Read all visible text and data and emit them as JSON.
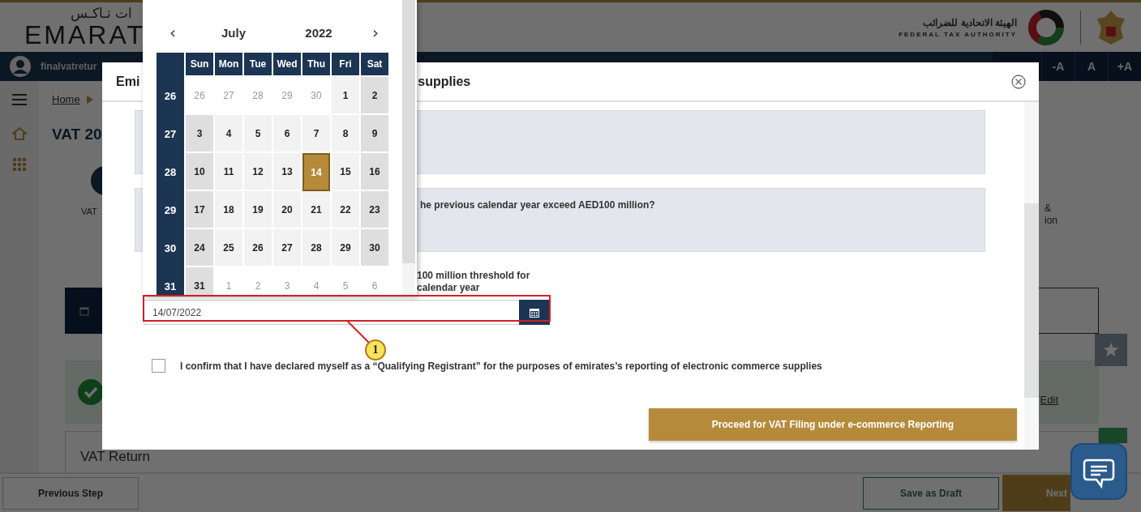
{
  "header": {
    "logo_arabic": "ات تـاكـس",
    "logo_text": "EMARAT",
    "authority_arabic": "الهيئة الاتحادية للضرائب",
    "authority_name": "FEDERAL TAX AUTHORITY"
  },
  "nav": {
    "user": "finalvatretur",
    "font_buttons": [
      "-A",
      "A",
      "+A"
    ]
  },
  "breadcrumb": {
    "home": "Home"
  },
  "page_title": "VAT 20",
  "steps": {
    "first_label": "VAT",
    "last_label_lines": [
      "&",
      "ion"
    ]
  },
  "summary_card": {
    "edit": "Edit"
  },
  "section_title": "VAT Return",
  "footer": {
    "previous": "Previous Step",
    "save": "Save as Draft",
    "next": "Next"
  },
  "modal": {
    "title_start": "Emi",
    "title_end": "supplies",
    "question_text": "he previous calendar year exceed AED100 million?",
    "threshold_lines": [
      "100 million threshold for",
      "calendar year"
    ],
    "date_value": "14/07/2022",
    "confirm": {
      "checked": false,
      "text": "I confirm that I have declared myself as a “Qualifying Registrant” for the purposes of emirates’s reporting of electronic commerce supplies"
    },
    "proceed": "Proceed for VAT Filing under e-commerce Reporting"
  },
  "calendar": {
    "prev": "‹",
    "month": "July",
    "year": "2022",
    "next": "›",
    "weekdays": [
      "Sun",
      "Mon",
      "Tue",
      "Wed",
      "Thu",
      "Fri",
      "Sat"
    ],
    "weeks": [
      {
        "number": "26",
        "days": [
          {
            "day": "26",
            "outside": true,
            "selected": false
          },
          {
            "day": "27",
            "outside": true,
            "selected": false
          },
          {
            "day": "28",
            "outside": true,
            "selected": false
          },
          {
            "day": "29",
            "outside": true,
            "selected": false
          },
          {
            "day": "30",
            "outside": true,
            "selected": false
          },
          {
            "day": "1",
            "outside": false,
            "selected": false
          },
          {
            "day": "2",
            "outside": false,
            "selected": false
          }
        ]
      },
      {
        "number": "27",
        "days": [
          {
            "day": "3",
            "outside": false,
            "selected": false
          },
          {
            "day": "4",
            "outside": false,
            "selected": false
          },
          {
            "day": "5",
            "outside": false,
            "selected": false
          },
          {
            "day": "6",
            "outside": false,
            "selected": false
          },
          {
            "day": "7",
            "outside": false,
            "selected": false
          },
          {
            "day": "8",
            "outside": false,
            "selected": false
          },
          {
            "day": "9",
            "outside": false,
            "selected": false
          }
        ]
      },
      {
        "number": "28",
        "days": [
          {
            "day": "10",
            "outside": false,
            "selected": false
          },
          {
            "day": "11",
            "outside": false,
            "selected": false
          },
          {
            "day": "12",
            "outside": false,
            "selected": false
          },
          {
            "day": "13",
            "outside": false,
            "selected": false
          },
          {
            "day": "14",
            "outside": false,
            "selected": true
          },
          {
            "day": "15",
            "outside": false,
            "selected": false
          },
          {
            "day": "16",
            "outside": false,
            "selected": false
          }
        ]
      },
      {
        "number": "29",
        "days": [
          {
            "day": "17",
            "outside": false,
            "selected": false
          },
          {
            "day": "18",
            "outside": false,
            "selected": false
          },
          {
            "day": "19",
            "outside": false,
            "selected": false
          },
          {
            "day": "20",
            "outside": false,
            "selected": false
          },
          {
            "day": "21",
            "outside": false,
            "selected": false
          },
          {
            "day": "22",
            "outside": false,
            "selected": false
          },
          {
            "day": "23",
            "outside": false,
            "selected": false
          }
        ]
      },
      {
        "number": "30",
        "days": [
          {
            "day": "24",
            "outside": false,
            "selected": false
          },
          {
            "day": "25",
            "outside": false,
            "selected": false
          },
          {
            "day": "26",
            "outside": false,
            "selected": false
          },
          {
            "day": "27",
            "outside": false,
            "selected": false
          },
          {
            "day": "28",
            "outside": false,
            "selected": false
          },
          {
            "day": "29",
            "outside": false,
            "selected": false
          },
          {
            "day": "30",
            "outside": false,
            "selected": false
          }
        ]
      },
      {
        "number": "31",
        "days": [
          {
            "day": "31",
            "outside": false,
            "selected": false
          },
          {
            "day": "1",
            "outside": true,
            "selected": false
          },
          {
            "day": "2",
            "outside": true,
            "selected": false
          },
          {
            "day": "3",
            "outside": true,
            "selected": false
          },
          {
            "day": "4",
            "outside": true,
            "selected": false
          },
          {
            "day": "5",
            "outside": true,
            "selected": false
          },
          {
            "day": "6",
            "outside": true,
            "selected": false
          }
        ]
      }
    ]
  },
  "callout": {
    "number": "1"
  }
}
